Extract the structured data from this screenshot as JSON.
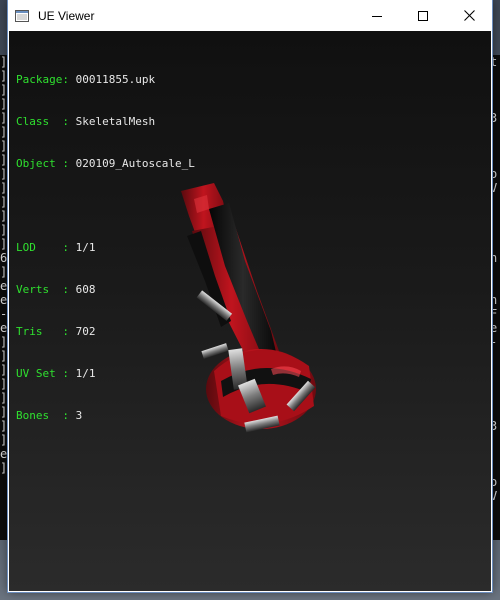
{
  "window": {
    "title": "UE Viewer",
    "icon": "ue-viewer-app-icon",
    "controls": {
      "minimize_icon": "minimize-icon",
      "maximize_icon": "maximize-icon",
      "close_icon": "close-icon"
    }
  },
  "info": {
    "package_label": "Package: ",
    "package_value": "00011855.upk",
    "class_label": "Class  : ",
    "class_value": "SkeletalMesh",
    "object_label": "Object : ",
    "object_value": "020109_Autoscale_L",
    "lod_label": "LOD    : ",
    "lod_value": "1/1",
    "verts_label": "Verts  : ",
    "verts_value": "608",
    "tris_label": "Tris   : ",
    "tris_value": "702",
    "uvset_label": "UV Set : ",
    "uvset_value": "1/1",
    "bones_label": "Bones  : ",
    "bones_value": "3"
  },
  "colors": {
    "label_green": "#2fe02f",
    "value_text": "#e8e8e8",
    "mesh_red": "#c0141e",
    "mesh_black": "#141414"
  },
  "background_console": {
    "left_chars": "]\n]\n]\n]\n]\n]\n]\n]\n]\n]\n]\n]\n]\n]\n6\n]\ne\ne\n-\ne\n]\n]\n]\n]\n]\n]\n]\n]\ne\n]",
    "right_chars": "t\n\n\n\n3\n\n\n\no\nV\n\n\n\n\nn\n\n\nn\nF\ne\n-\n\n\n\n\n\n3\n\n\n\no\nV"
  }
}
